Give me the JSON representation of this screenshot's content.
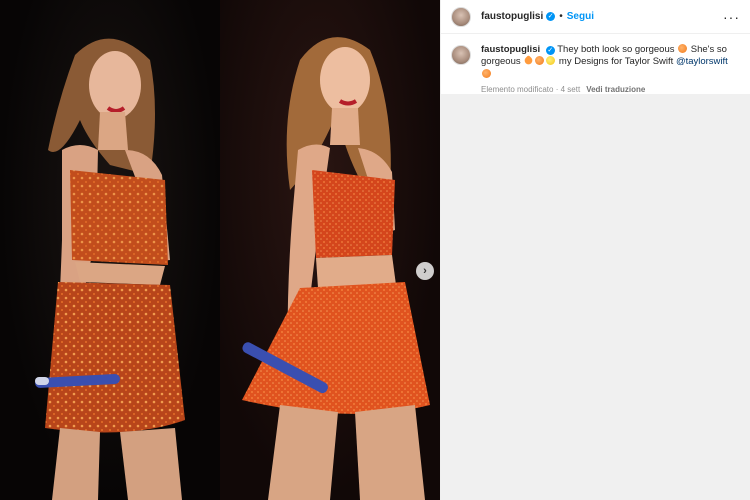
{
  "post": {
    "username": "faustopuglisi",
    "dot": "•",
    "follow_label": "Segui",
    "more_label": "···",
    "next_label": "›"
  },
  "caption": {
    "username": "faustopuglisi",
    "text_1": "They both look so gorgeous",
    "text_2": "She's so gorgeous",
    "text_3": "my Designs for Taylor Swift",
    "mention": "@taylorswift",
    "edited_label": "Elemento modificato",
    "time_sep": "·",
    "time": "4 sett",
    "translate_label": "Vedi traduzione"
  },
  "colors": {
    "accent": "#0095f6",
    "dress": "#e0531f"
  }
}
